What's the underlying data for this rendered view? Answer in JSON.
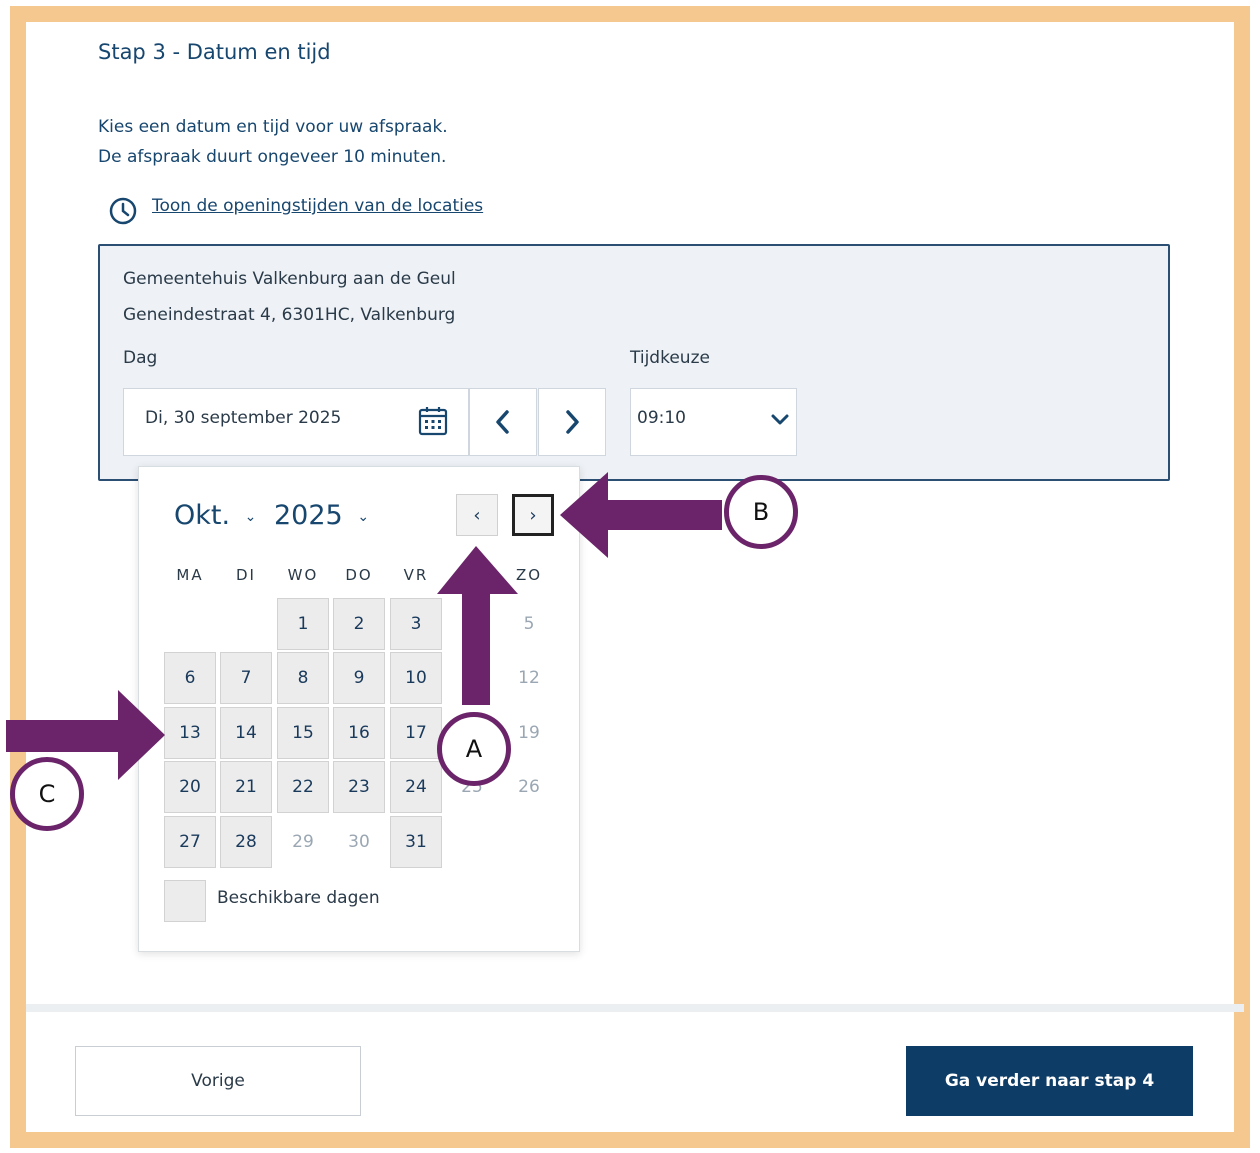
{
  "step": {
    "title": "Stap 3 - Datum en tijd"
  },
  "intro": {
    "line1": "Kies een datum en tijd voor uw afspraak.",
    "line2": "De afspraak duurt ongeveer 10 minuten."
  },
  "hours_link": "Toon de openingstijden van de locaties",
  "location": {
    "name": "Gemeentehuis Valkenburg aan de Geul",
    "address": "Geneindestraat 4, 6301HC, Valkenburg"
  },
  "day_field": {
    "label": "Dag",
    "value": "Di, 30 september 2025"
  },
  "time_field": {
    "label": "Tijdkeuze",
    "value": "09:10"
  },
  "calendar": {
    "month": "Okt.",
    "year": "2025",
    "weekdays": [
      "MA",
      "DI",
      "WO",
      "DO",
      "VR",
      "",
      "ZO"
    ],
    "days": [
      [
        "",
        "",
        "1",
        "2",
        "3",
        "",
        "5"
      ],
      [
        "6",
        "7",
        "8",
        "9",
        "10",
        "",
        "12"
      ],
      [
        "13",
        "14",
        "15",
        "16",
        "17",
        "",
        "19"
      ],
      [
        "20",
        "21",
        "22",
        "23",
        "24",
        "25",
        "26"
      ],
      [
        "27",
        "28",
        "29",
        "30",
        "31",
        "",
        ""
      ]
    ],
    "available": [
      [
        false,
        false,
        true,
        true,
        true,
        false,
        false
      ],
      [
        true,
        true,
        true,
        true,
        true,
        false,
        false
      ],
      [
        true,
        true,
        true,
        true,
        true,
        false,
        false
      ],
      [
        true,
        true,
        true,
        true,
        true,
        false,
        false
      ],
      [
        true,
        true,
        false,
        false,
        true,
        false,
        false
      ]
    ],
    "legend": "Beschikbare dagen"
  },
  "buttons": {
    "prev": "Vorige",
    "next": "Ga verder naar stap 4"
  },
  "annotations": {
    "a": "A",
    "b": "B",
    "c": "C"
  },
  "colors": {
    "frame": "#f5c88f",
    "arrow": "#6b2469",
    "primary": "#0d3c66",
    "panel": "#eef2f6",
    "available_day": "#ececec"
  }
}
